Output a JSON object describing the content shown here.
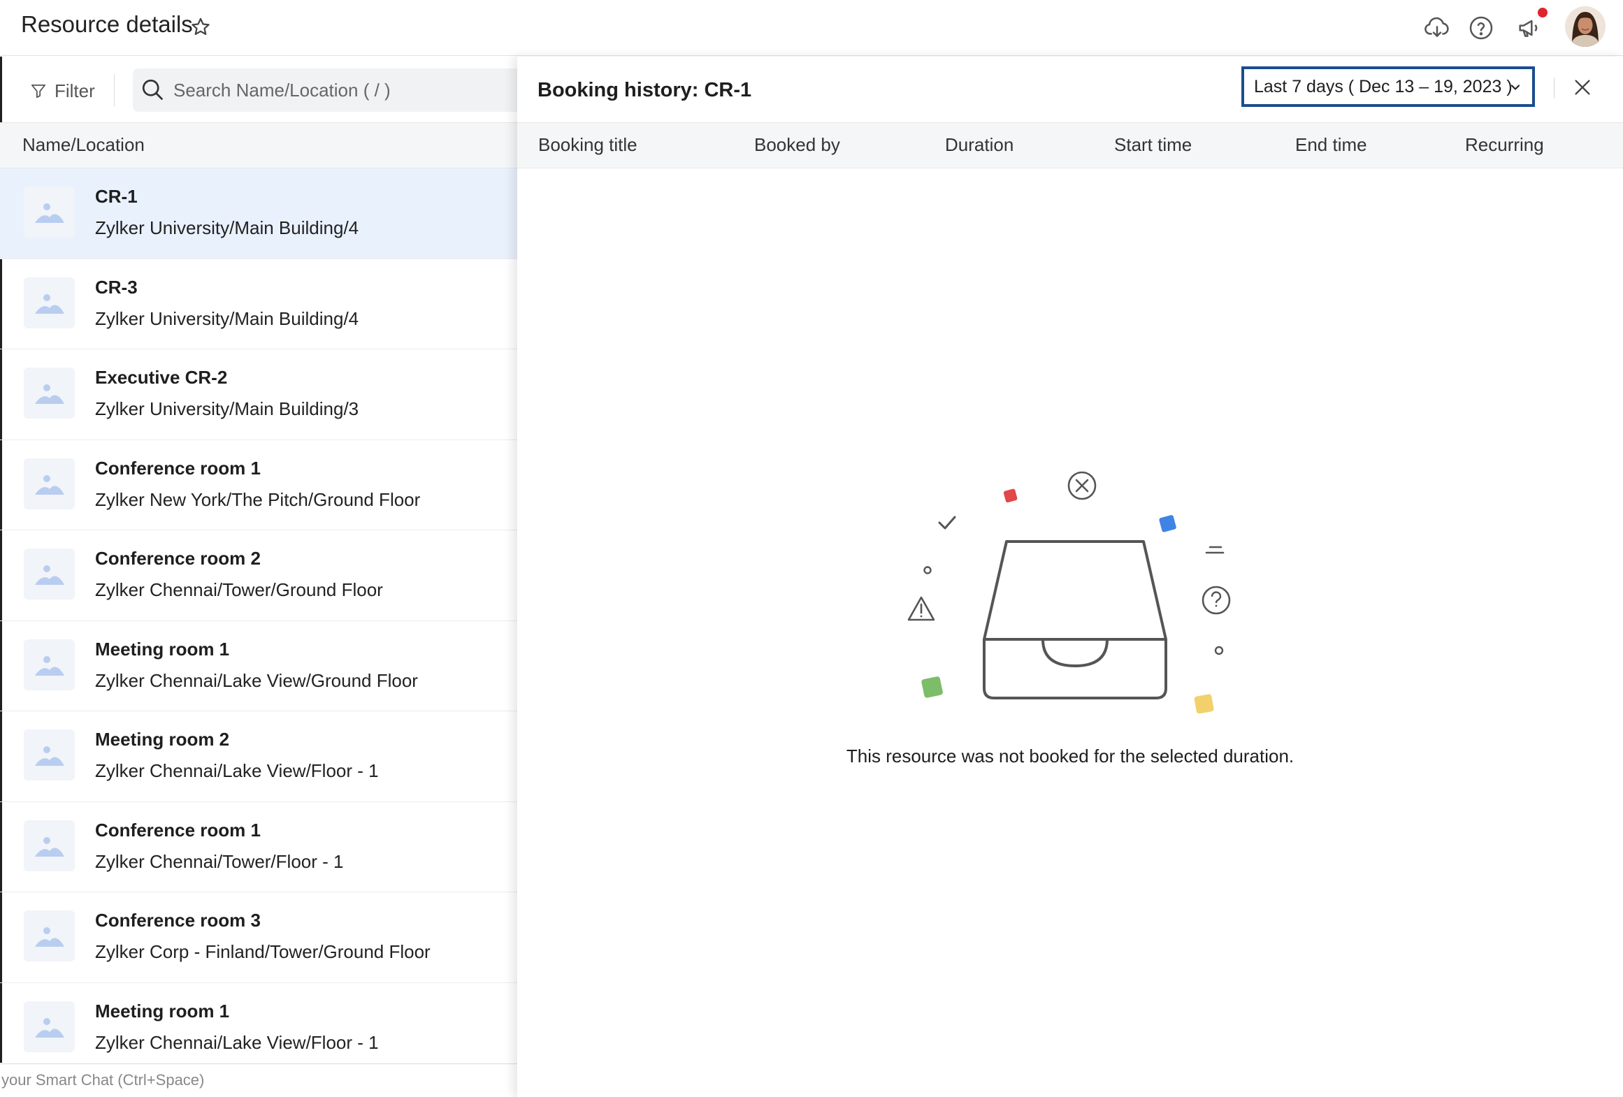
{
  "header": {
    "title": "Resource details",
    "icons": [
      "star-icon",
      "cloud-download-icon",
      "help-icon",
      "announcement-icon",
      "avatar"
    ]
  },
  "sidebar": {
    "filter_label": "Filter",
    "search_placeholder": "Search Name/Location ( / )",
    "column_header": "Name/Location",
    "items": [
      {
        "name": "CR-1",
        "location": "Zylker University/Main Building/4",
        "selected": true
      },
      {
        "name": "CR-3",
        "location": "Zylker University/Main Building/4"
      },
      {
        "name": "Executive CR-2",
        "location": "Zylker University/Main Building/3"
      },
      {
        "name": "Conference room 1",
        "location": "Zylker New York/The Pitch/Ground Floor"
      },
      {
        "name": "Conference room 2",
        "location": "Zylker Chennai/Tower/Ground Floor"
      },
      {
        "name": "Meeting room 1",
        "location": "Zylker Chennai/Lake View/Ground Floor"
      },
      {
        "name": "Meeting room 2",
        "location": "Zylker Chennai/Lake View/Floor - 1"
      },
      {
        "name": "Conference room 1",
        "location": "Zylker Chennai/Tower/Floor - 1"
      },
      {
        "name": "Conference room 3",
        "location": "Zylker Corp - Finland/Tower/Ground Floor"
      },
      {
        "name": "Meeting room 1",
        "location": "Zylker Chennai/Lake View/Floor - 1"
      }
    ],
    "smartchat_placeholder": "your Smart Chat (Ctrl+Space)"
  },
  "panel": {
    "title": "Booking history: CR-1",
    "date_range": "Last 7 days ( Dec 13 – 19, 2023 )",
    "columns": [
      "Booking title",
      "Booked by",
      "Duration",
      "Start time",
      "End time",
      "Recurring"
    ],
    "empty_message": "This resource was not booked for the selected duration."
  },
  "colors": {
    "accent_border": "#1a4d8f",
    "selected_row": "#e9f1fd",
    "notification_dot": "#e0242c"
  }
}
